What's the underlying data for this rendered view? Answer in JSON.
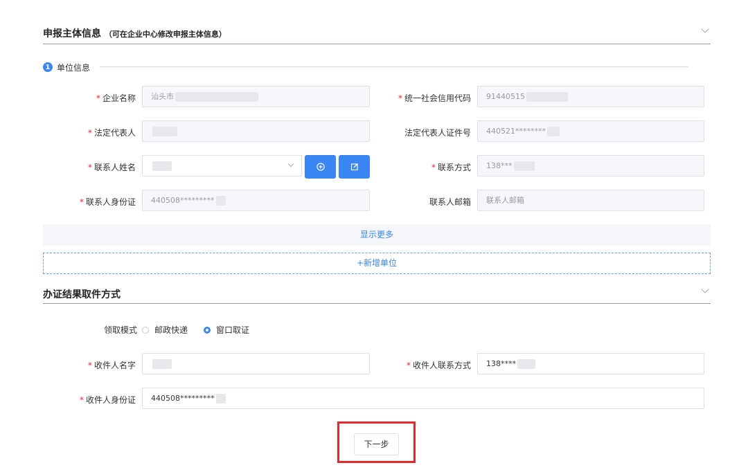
{
  "section1": {
    "title": "申报主体信息",
    "hint": "（可在企业中心修改申报主体信息）",
    "step_number": "1",
    "step_label": "单位信息"
  },
  "fields": {
    "company_name": {
      "label": "企业名称",
      "value": "汕头市"
    },
    "credit_code": {
      "label": "统一社会信用代码",
      "value": "91440515"
    },
    "legal_rep": {
      "label": "法定代表人",
      "value": ""
    },
    "legal_rep_id": {
      "label": "法定代表人证件号",
      "value": "440521********"
    },
    "contact_name": {
      "label": "联系人姓名",
      "value": ""
    },
    "contact_phone": {
      "label": "联系方式",
      "value": "138***"
    },
    "contact_id": {
      "label": "联系人身份证",
      "value": "440508*********"
    },
    "contact_email": {
      "label": "联系人邮箱",
      "placeholder": "联系人邮箱"
    }
  },
  "actions": {
    "show_more": "显示更多",
    "add_unit": "+新增单位",
    "next": "下一步"
  },
  "section2": {
    "title": "办证结果取件方式",
    "pickup_label": "领取模式",
    "options": [
      "邮政快递",
      "窗口取证"
    ],
    "selected": "窗口取证",
    "receiver_name": {
      "label": "收件人名字",
      "value": ""
    },
    "receiver_phone": {
      "label": "收件人联系方式",
      "value": "138****"
    },
    "receiver_id": {
      "label": "收件人身份证",
      "value": "440508*********"
    }
  },
  "colors": {
    "accent": "#3a86f5",
    "required": "#f5222d",
    "highlight": "#e8262c"
  }
}
